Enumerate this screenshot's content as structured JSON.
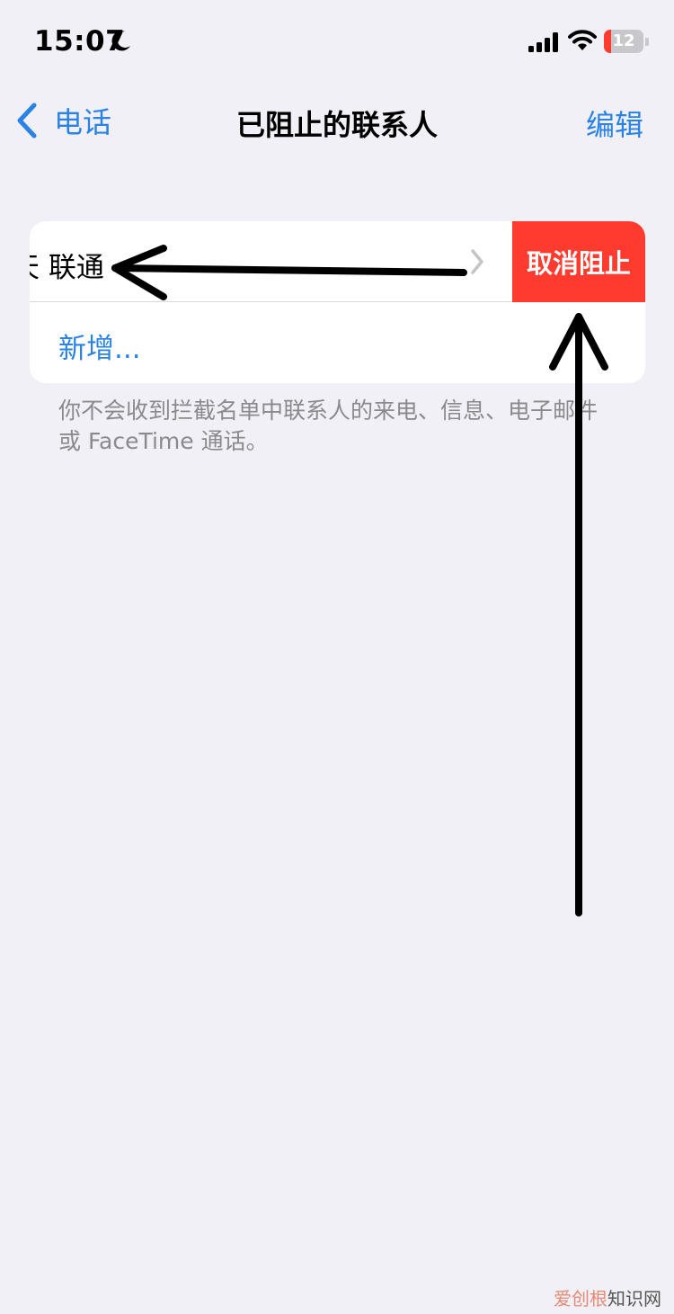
{
  "status_bar": {
    "time": "15:07",
    "battery_level": "12",
    "battery_fraction": 0.12,
    "icons": [
      "moon-icon",
      "signal-icon",
      "wifi-icon",
      "battery-icon"
    ]
  },
  "nav": {
    "back_label": "电话",
    "title": "已阻止的联系人",
    "edit_label": "编辑"
  },
  "blocked_list": {
    "contact_name": "天 联通",
    "unblock_label": "取消阻止",
    "add_label": "新增..."
  },
  "footer_note": "你不会收到拦截名单中联系人的来电、信息、电子邮件或 FaceTime 通话。",
  "watermark": {
    "brand": "爱创根",
    "site": "知识网"
  },
  "colors": {
    "accent": "#2a82e4",
    "destructive": "#ff3b30",
    "background": "#f1f0f6",
    "annotation": "#000000"
  }
}
